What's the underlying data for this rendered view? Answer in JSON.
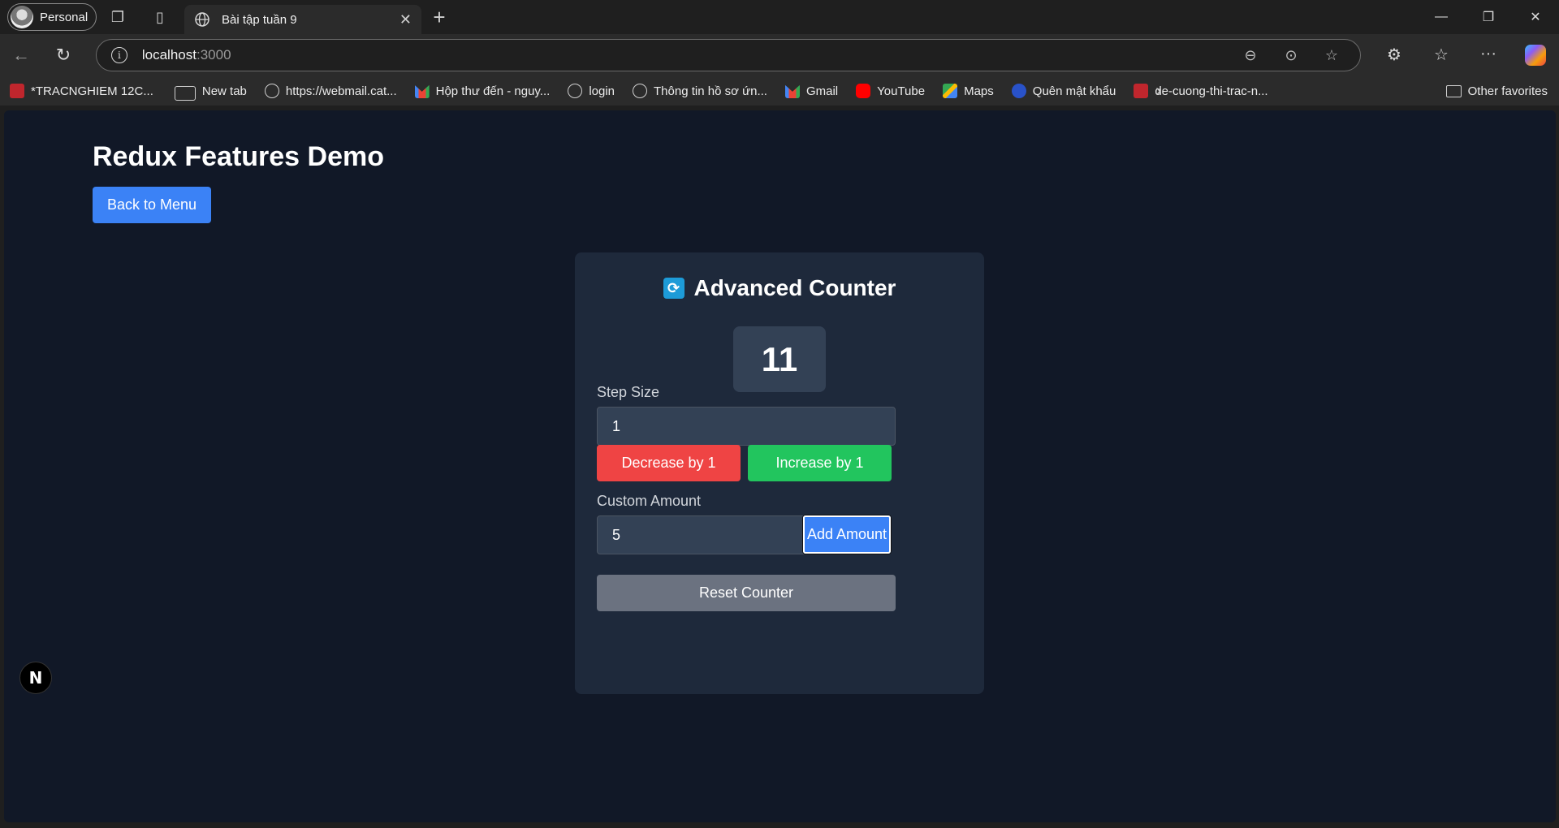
{
  "browser": {
    "profile_label": "Personal",
    "tab_title": "Bài tập tuần 9",
    "url_host": "localhost",
    "url_port": ":3000",
    "bookmarks": [
      {
        "label": "*TRACNGHIEM 12C...",
        "icon": "pdf-icon"
      },
      {
        "label": "New tab",
        "icon": "tab-icon"
      },
      {
        "label": "https://webmail.cat...",
        "icon": "globe-icon"
      },
      {
        "label": "Hộp thư đến - nguy...",
        "icon": "gmail-icon"
      },
      {
        "label": "login",
        "icon": "globe-icon"
      },
      {
        "label": "Thông tin hồ sơ ứn...",
        "icon": "globe-icon"
      },
      {
        "label": "Gmail",
        "icon": "gmail-icon"
      },
      {
        "label": "YouTube",
        "icon": "youtube-icon"
      },
      {
        "label": "Maps",
        "icon": "maps-icon"
      },
      {
        "label": "Quên mật khẩu",
        "icon": "key-icon"
      },
      {
        "label": "de-cuong-thi-trac-n...",
        "icon": "pdf-icon"
      }
    ],
    "other_favorites": "Other favorites"
  },
  "page": {
    "title": "Redux Features Demo",
    "back_button": "Back to Menu"
  },
  "counter": {
    "heading": "Advanced Counter",
    "value": "11",
    "step_label": "Step Size",
    "step_value": "1",
    "decrease_label": "Decrease by 1",
    "increase_label": "Increase by 1",
    "custom_label": "Custom Amount",
    "custom_value": "5",
    "add_label": "Add Amount",
    "reset_label": "Reset Counter"
  },
  "colors": {
    "page_bg": "#111827",
    "card_bg": "#1e293b",
    "primary": "#3b82f6",
    "danger": "#ef4444",
    "success": "#22c55e",
    "neutral": "#6b7280"
  }
}
